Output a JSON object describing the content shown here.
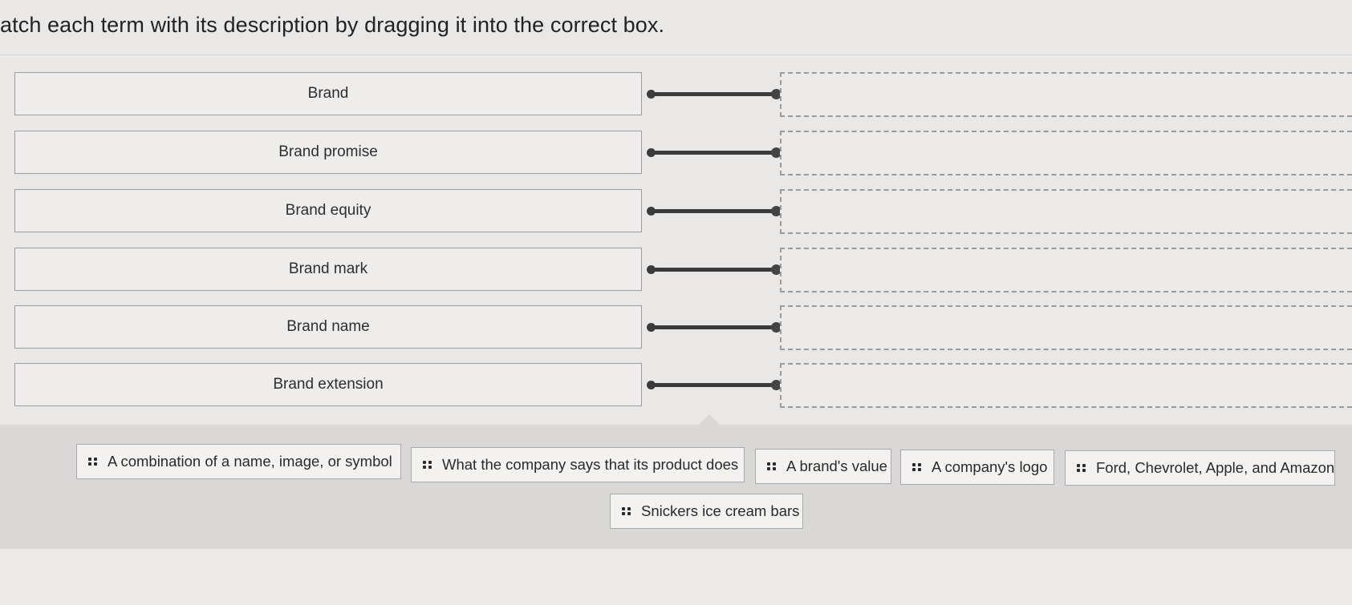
{
  "instruction": "atch each term with its description by dragging it into the correct box.",
  "terms": [
    {
      "label": "Brand"
    },
    {
      "label": "Brand promise"
    },
    {
      "label": "Brand equity"
    },
    {
      "label": "Brand mark"
    },
    {
      "label": "Brand name"
    },
    {
      "label": "Brand extension"
    }
  ],
  "drop_zones": [
    {
      "value": ""
    },
    {
      "value": ""
    },
    {
      "value": ""
    },
    {
      "value": ""
    },
    {
      "value": ""
    },
    {
      "value": ""
    }
  ],
  "answer_bank": [
    {
      "label": "A combination of a name, image, or symbol",
      "icon": "drag-handle-icon"
    },
    {
      "label": "What the company says that its product does",
      "icon": "drag-handle-icon"
    },
    {
      "label": "A brand's value",
      "icon": "drag-handle-icon"
    },
    {
      "label": "A company's logo",
      "icon": "drag-handle-icon"
    },
    {
      "label": "Ford, Chevrolet, Apple, and Amazon",
      "icon": "drag-handle-icon"
    },
    {
      "label": "Snickers ice cream bars",
      "icon": "drag-handle-icon"
    }
  ],
  "colors": {
    "page_background": "#e9e8e6",
    "bank_background": "#d9d8d6",
    "connector": "#3b3b3b",
    "border": "#9c9c9c"
  }
}
